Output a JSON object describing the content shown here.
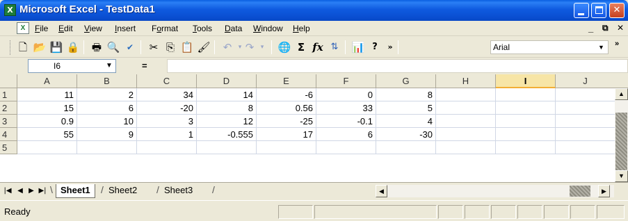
{
  "window": {
    "title": "Microsoft Excel - TestData1",
    "app_icon": "excel-icon",
    "min_label": "",
    "max_label": "",
    "close_label": "✕"
  },
  "menu": {
    "items": [
      {
        "key": "F",
        "rest": "ile"
      },
      {
        "key": "E",
        "rest": "dit"
      },
      {
        "key": "V",
        "rest": "iew"
      },
      {
        "key": "I",
        "rest": "nsert"
      },
      {
        "key": "o",
        "pre": "F",
        "rest": "rmat"
      },
      {
        "key": "T",
        "rest": "ools"
      },
      {
        "key": "D",
        "rest": "ata"
      },
      {
        "key": "W",
        "rest": "indow"
      },
      {
        "key": "H",
        "rest": "elp"
      }
    ],
    "controls": [
      "_",
      "⧉",
      "✕"
    ]
  },
  "toolbar": {
    "font_name": "Arial",
    "icons": [
      "new-icon",
      "open-icon",
      "save-icon",
      "permission-icon",
      "print-icon",
      "print-preview-icon",
      "spelling-icon",
      "cut-icon",
      "copy-icon",
      "paste-icon",
      "format-painter-icon",
      "undo-icon",
      "redo-icon",
      "hyperlink-icon",
      "autosum-icon",
      "function-icon",
      "sort-ascending-icon",
      "chart-wizard-icon",
      "help-icon",
      "more-options-icon"
    ]
  },
  "formula_bar": {
    "name_box": "I6",
    "equals": "=",
    "formula": ""
  },
  "grid": {
    "columns": [
      "A",
      "B",
      "C",
      "D",
      "E",
      "F",
      "G",
      "H",
      "I",
      "J"
    ],
    "active_column": "I",
    "rows": [
      {
        "label": "1",
        "cells": [
          "11",
          "2",
          "34",
          "14",
          "-6",
          "0",
          "8",
          "",
          "",
          ""
        ]
      },
      {
        "label": "2",
        "cells": [
          "15",
          "6",
          "-20",
          "8",
          "0.56",
          "33",
          "5",
          "",
          "",
          ""
        ]
      },
      {
        "label": "3",
        "cells": [
          "0.9",
          "10",
          "3",
          "12",
          "-25",
          "-0.1",
          "4",
          "",
          "",
          ""
        ]
      },
      {
        "label": "4",
        "cells": [
          "55",
          "9",
          "1",
          "-0.555",
          "17",
          "6",
          "-30",
          "",
          "",
          ""
        ]
      },
      {
        "label": "5",
        "cells": [
          "",
          "",
          "",
          "",
          "",
          "",
          "",
          "",
          "",
          ""
        ]
      }
    ]
  },
  "sheets": {
    "tabs": [
      "Sheet1",
      "Sheet2",
      "Sheet3"
    ],
    "active": "Sheet1"
  },
  "status": {
    "text": "Ready"
  }
}
